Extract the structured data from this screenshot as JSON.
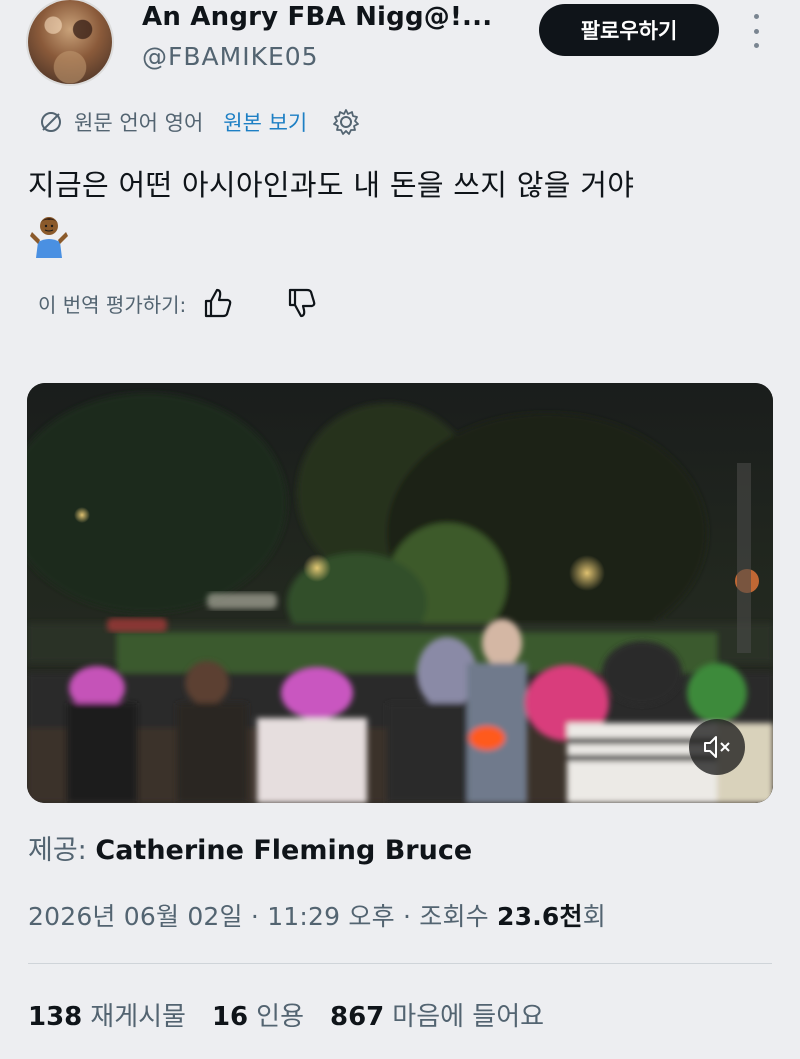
{
  "user": {
    "display_name": "An Angry FBA Nigg@!...",
    "handle": "@FBAMIKE05",
    "follow_label": "팔로우하기"
  },
  "translation": {
    "original_language": "원문 언어 영어",
    "view_original": "원본 보기"
  },
  "tweet": {
    "text": "지금은 어떤 아시아인과도 내 돈을 쓰지 않을 거야",
    "emoji": "shrug-emoji"
  },
  "rating": {
    "label": "이 번역 평가하기:"
  },
  "media": {
    "credit_prefix": "제공:",
    "credit_name": "Catherine Fleming Bruce",
    "mute_icon": "muted-speaker-icon"
  },
  "meta": {
    "date": "2026년 06월 02일",
    "time": "11:29 오후",
    "views_label": "조회수",
    "views_value": "23.6천",
    "views_suffix": "회"
  },
  "stats": {
    "reposts_value": "138",
    "reposts_label": "재게시물",
    "quotes_value": "16",
    "quotes_label": "인용",
    "likes_value": "867",
    "likes_label": "마음에 들어요"
  },
  "colors": {
    "background": "#edeef1",
    "link": "#1d7fc4",
    "follow_button": "#0f1419",
    "secondary_text": "#536471"
  }
}
